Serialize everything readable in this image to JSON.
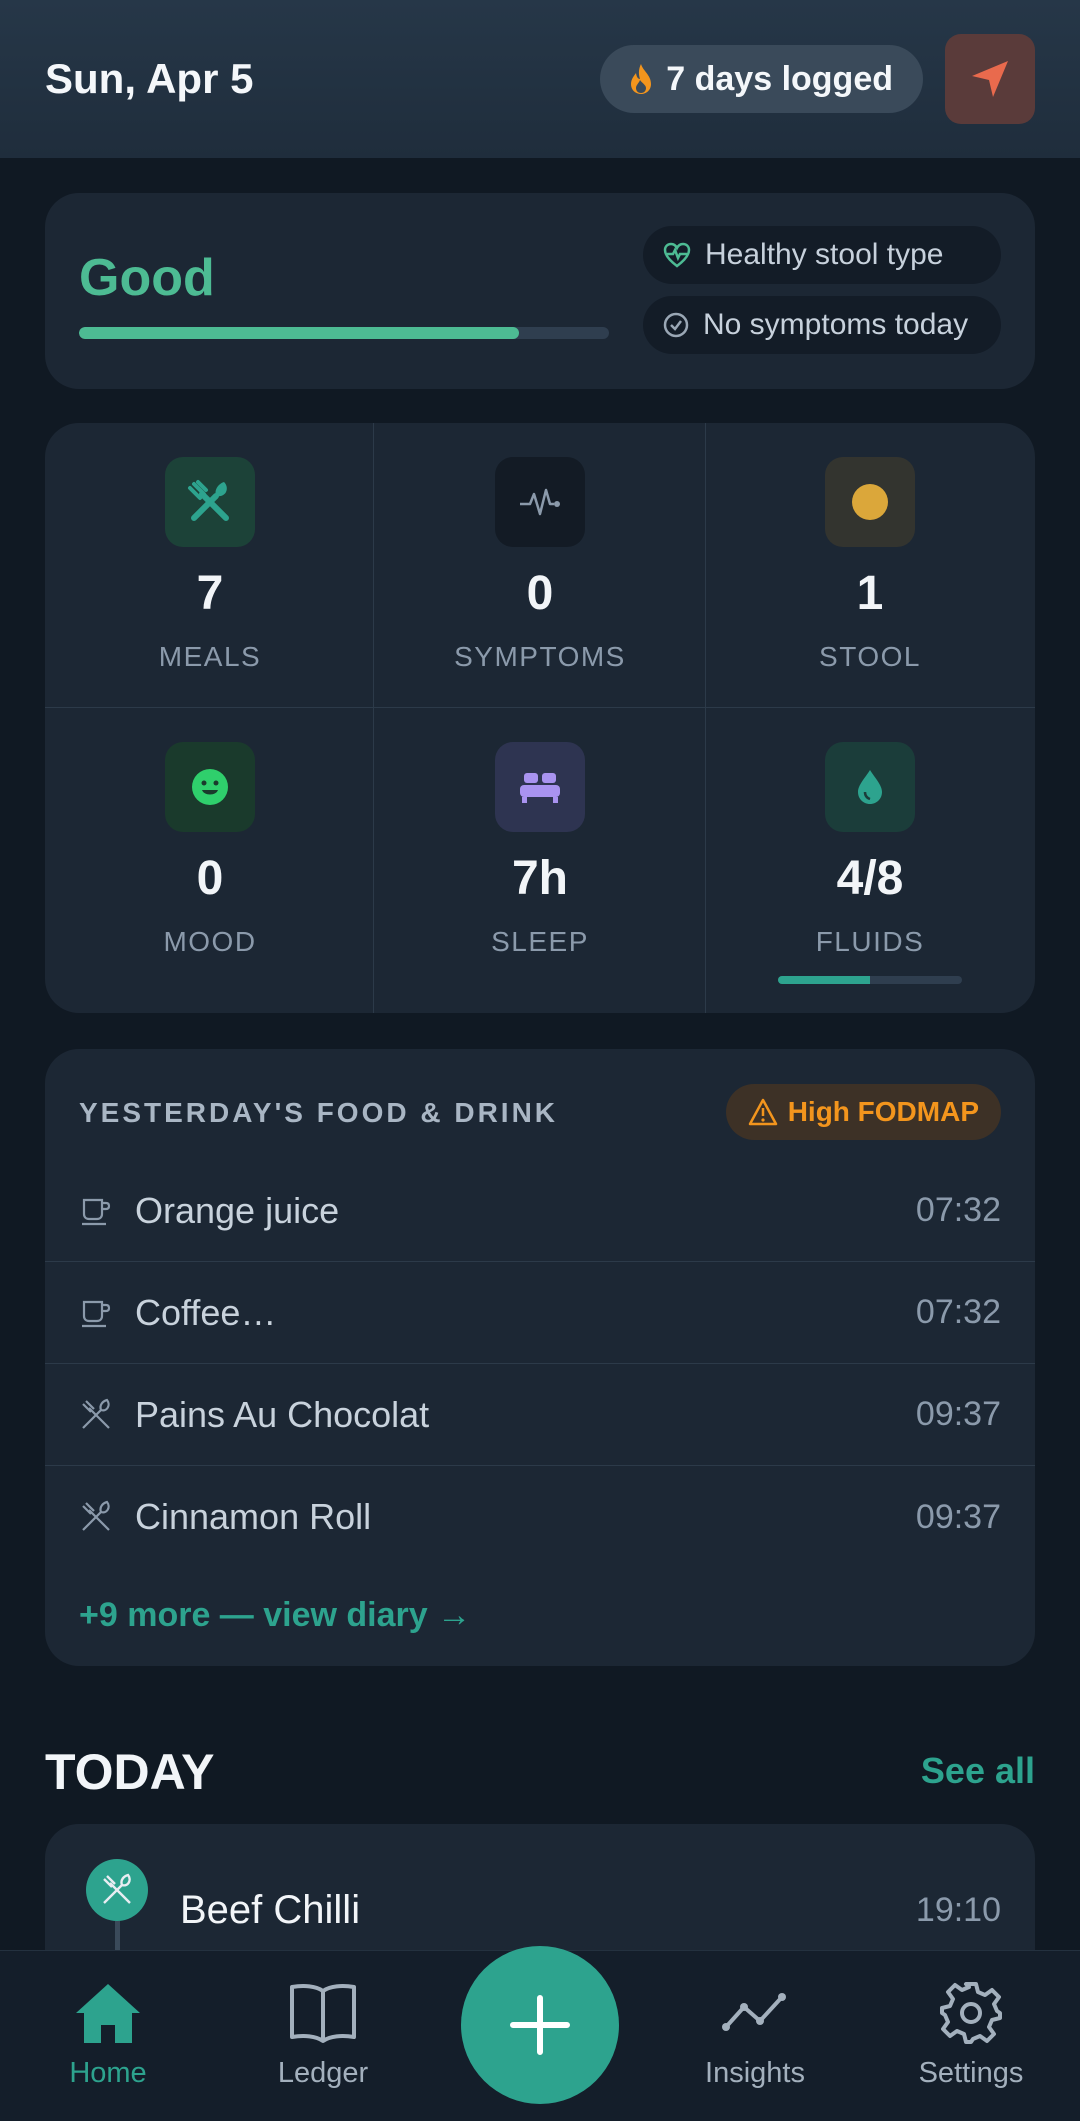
{
  "header": {
    "date": "Sun, Apr 5",
    "streak_label": "7 days logged"
  },
  "status": {
    "rating": "Good",
    "progress": 0.83,
    "chips": [
      {
        "label": "Healthy stool type",
        "icon": "heart-pulse-icon"
      },
      {
        "label": "No symptoms today",
        "icon": "check-circle-icon"
      }
    ]
  },
  "stats": [
    {
      "value": "7",
      "label": "MEALS",
      "icon": "utensils-icon"
    },
    {
      "value": "0",
      "label": "SYMPTOMS",
      "icon": "activity-icon"
    },
    {
      "value": "1",
      "label": "STOOL",
      "icon": "dot-icon"
    },
    {
      "value": "0",
      "label": "MOOD",
      "icon": "smile-icon"
    },
    {
      "value": "7h",
      "label": "SLEEP",
      "icon": "bed-icon"
    },
    {
      "value": "4/8",
      "label": "FLUIDS",
      "icon": "droplet-icon",
      "progress": 0.5
    }
  ],
  "food": {
    "title": "YESTERDAY'S FOOD & DRINK",
    "badge": "High FODMAP",
    "items": [
      {
        "name": "Orange juice",
        "time": "07:32",
        "icon": "cup-icon"
      },
      {
        "name": "Coffee…",
        "time": "07:32",
        "icon": "cup-icon"
      },
      {
        "name": "Pains Au Chocolat",
        "time": "09:37",
        "icon": "utensils-icon"
      },
      {
        "name": "Cinnamon Roll",
        "time": "09:37",
        "icon": "utensils-icon"
      }
    ],
    "more_link": "+9 more — view diary →"
  },
  "today": {
    "title": "TODAY",
    "see_all": "See all",
    "entries": [
      {
        "name": "Beef Chilli",
        "time": "19:10",
        "icon": "utensils-icon"
      }
    ]
  },
  "nav": {
    "items": [
      {
        "label": "Home",
        "icon": "home-icon",
        "active": true
      },
      {
        "label": "Ledger",
        "icon": "book-icon"
      },
      {
        "label": "Insights",
        "icon": "chart-line-icon"
      },
      {
        "label": "Settings",
        "icon": "gear-icon"
      }
    ],
    "fab_icon": "plus-icon"
  },
  "colors": {
    "accent": "#2da38e",
    "good": "#4dbb93",
    "warning": "#f3951d",
    "background": "#101923",
    "card": "#1c2734"
  }
}
